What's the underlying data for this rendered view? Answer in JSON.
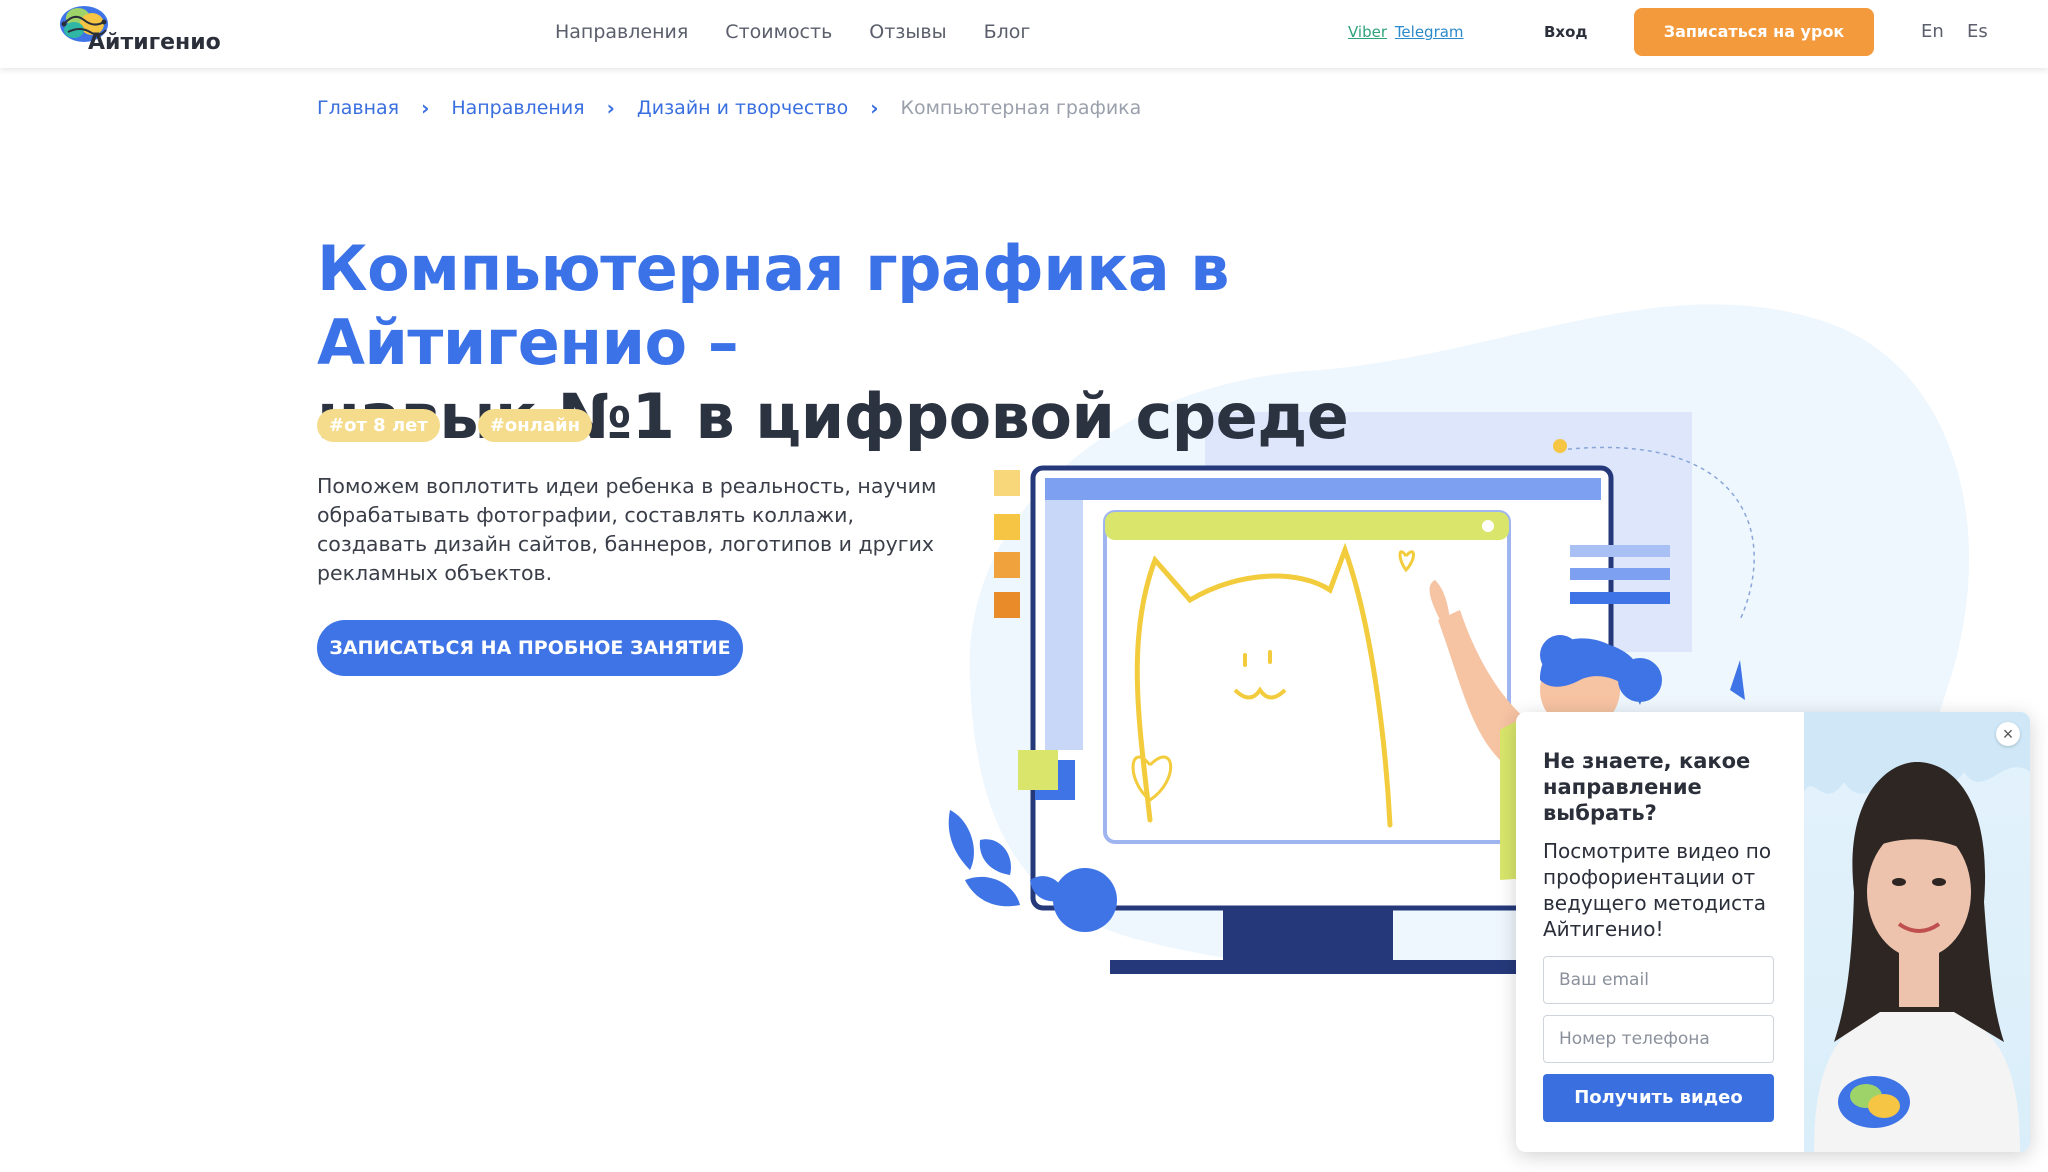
{
  "header": {
    "logo_text": "Айтигенио",
    "nav": [
      "Направления",
      "Стоимость",
      "Отзывы",
      "Блог"
    ],
    "messengers": {
      "viber": "Viber",
      "telegram": "Telegram"
    },
    "login": "Вход",
    "cta": "Записаться на урок",
    "languages": [
      "En",
      "Es"
    ]
  },
  "breadcrumb": [
    "Главная",
    "Направления",
    "Дизайн и творчество",
    "Компьютерная графика"
  ],
  "hero": {
    "title_line1": "Компьютерная графика в Айтигенио –",
    "title_line2": "навык №1 в цифровой среде",
    "tags": [
      "#от 8 лет",
      "#онлайн"
    ],
    "description": "Поможем воплотить идеи ребенка в реальность, научим обрабатывать фотографии, составлять коллажи, создавать дизайн сайтов, баннеров, логотипов и других рекламных объектов.",
    "cta": "ЗАПИСАТЬСЯ НА ПРОБНОЕ ЗАНЯТИЕ"
  },
  "popup": {
    "close": "×",
    "title": "Не знаете, какое направление выбрать?",
    "text": "Посмотрите видео по профориентации от ведущего методиста Айтигенио!",
    "email_placeholder": "Ваш email",
    "phone_placeholder": "Номер телефона",
    "button": "Получить видео"
  },
  "colors": {
    "accent_blue": "#3f74e6",
    "title_dark": "#2b3240",
    "cta_orange": "#f39a3c",
    "tag_yellow": "#f5dc8c",
    "illus_lime": "#d9e66b"
  },
  "icons": [
    "brain-logo-icon",
    "chevron-right-icon",
    "close-icon",
    "monitor-illustration",
    "girl-illustration"
  ]
}
